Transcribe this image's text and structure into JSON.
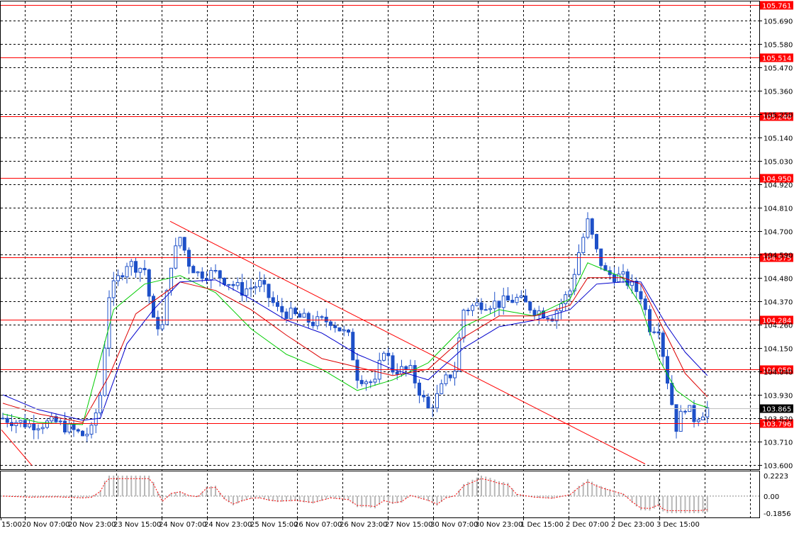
{
  "chart_data": {
    "type": "candlestick",
    "title": "",
    "price_axis": {
      "range": [
        103.58,
        105.775
      ],
      "ticks": [
        "105.690",
        "105.580",
        "105.470",
        "105.360",
        "105.250",
        "105.140",
        "105.030",
        "104.920",
        "104.810",
        "104.700",
        "104.590",
        "104.480",
        "104.370",
        "104.260",
        "104.150",
        "104.040",
        "103.930",
        "103.820",
        "103.710",
        "103.600"
      ]
    },
    "time_axis": {
      "labels": [
        "15:00",
        "20 Nov 07:00",
        "20 Nov 23:00",
        "23 Nov 15:00",
        "24 Nov 07:00",
        "24 Nov 23:00",
        "25 Nov 15:00",
        "26 Nov 07:00",
        "26 Nov 23:00",
        "27 Nov 15:00",
        "30 Nov 07:00",
        "30 Nov 23:00",
        "1 Dec 15:00",
        "2 Dec 07:00",
        "2 Dec 23:00",
        "3 Dec 15:00"
      ]
    },
    "current_price": "103.865",
    "levels": [
      {
        "price": "105.761",
        "value": 105.761
      },
      {
        "price": "105.514",
        "value": 105.514
      },
      {
        "price": "105.240",
        "value": 105.24
      },
      {
        "price": "104.950",
        "value": 104.95
      },
      {
        "price": "104.575",
        "value": 104.575
      },
      {
        "price": "104.284",
        "value": 104.284
      },
      {
        "price": "104.050",
        "value": 104.05
      },
      {
        "price": "103.796",
        "value": 103.796
      }
    ],
    "trendline": {
      "from_price": 104.745,
      "to_price": 103.605
    },
    "moving_averages": [
      {
        "color": "#00cc00",
        "anchors": [
          [
            0,
            103.84
          ],
          [
            8,
            103.8
          ],
          [
            18,
            103.79
          ],
          [
            25,
            104.33
          ],
          [
            32,
            104.45
          ],
          [
            40,
            104.49
          ],
          [
            48,
            104.41
          ],
          [
            56,
            104.24
          ],
          [
            64,
            104.12
          ],
          [
            72,
            104.05
          ],
          [
            80,
            103.95
          ],
          [
            88,
            104.0
          ],
          [
            96,
            104.08
          ],
          [
            104,
            104.25
          ],
          [
            112,
            104.33
          ],
          [
            120,
            104.3
          ],
          [
            128,
            104.38
          ],
          [
            132,
            104.55
          ],
          [
            140,
            104.48
          ],
          [
            144,
            104.35
          ],
          [
            148,
            104.1
          ],
          [
            152,
            103.95
          ],
          [
            156,
            103.89
          ],
          [
            159,
            103.87
          ]
        ]
      },
      {
        "color": "#dd0000",
        "anchors": [
          [
            0,
            103.89
          ],
          [
            8,
            103.84
          ],
          [
            18,
            103.8
          ],
          [
            24,
            104.02
          ],
          [
            30,
            104.31
          ],
          [
            40,
            104.46
          ],
          [
            48,
            104.42
          ],
          [
            56,
            104.33
          ],
          [
            64,
            104.21
          ],
          [
            72,
            104.1
          ],
          [
            80,
            104.06
          ],
          [
            88,
            104.02
          ],
          [
            96,
            104.05
          ],
          [
            104,
            104.2
          ],
          [
            112,
            104.3
          ],
          [
            120,
            104.3
          ],
          [
            128,
            104.35
          ],
          [
            132,
            104.48
          ],
          [
            140,
            104.48
          ],
          [
            144,
            104.45
          ],
          [
            150,
            104.2
          ],
          [
            154,
            104.03
          ],
          [
            159,
            103.92
          ]
        ]
      },
      {
        "color": "#0000cc",
        "anchors": [
          [
            0,
            103.93
          ],
          [
            8,
            103.86
          ],
          [
            18,
            103.81
          ],
          [
            22,
            103.82
          ],
          [
            28,
            104.17
          ],
          [
            34,
            104.33
          ],
          [
            40,
            104.46
          ],
          [
            48,
            104.47
          ],
          [
            56,
            104.38
          ],
          [
            64,
            104.28
          ],
          [
            72,
            104.22
          ],
          [
            80,
            104.12
          ],
          [
            88,
            104.05
          ],
          [
            96,
            104.0
          ],
          [
            104,
            104.15
          ],
          [
            112,
            104.25
          ],
          [
            120,
            104.28
          ],
          [
            128,
            104.33
          ],
          [
            134,
            104.45
          ],
          [
            140,
            104.46
          ],
          [
            144,
            104.46
          ],
          [
            150,
            104.25
          ],
          [
            154,
            104.13
          ],
          [
            159,
            104.02
          ]
        ]
      }
    ],
    "oscillator": {
      "range": [
        -0.1856,
        0.2223
      ],
      "ticks": [
        "0.2223",
        "0.00",
        "-0.1856"
      ]
    }
  }
}
